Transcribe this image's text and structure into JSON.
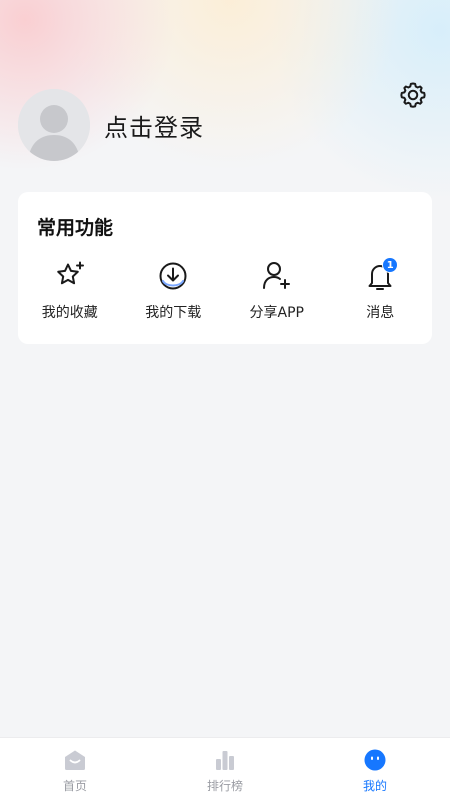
{
  "header": {
    "settings_icon": "gear-icon"
  },
  "profile": {
    "avatar_icon": "user-avatar-placeholder",
    "login_text": "点击登录"
  },
  "common_functions": {
    "title": "常用功能",
    "items": [
      {
        "label": "我的收藏",
        "icon": "star-sparkle-icon"
      },
      {
        "label": "我的下载",
        "icon": "download-icon"
      },
      {
        "label": "分享APP",
        "icon": "add-user-icon"
      },
      {
        "label": "消息",
        "icon": "bell-icon",
        "badge": "1"
      }
    ]
  },
  "tabbar": {
    "tabs": [
      {
        "label": "首页",
        "icon": "home-icon",
        "active": false
      },
      {
        "label": "排行榜",
        "icon": "bar-chart-icon",
        "active": false
      },
      {
        "label": "我的",
        "icon": "smile-face-icon",
        "active": true
      }
    ]
  },
  "colors": {
    "accent": "#1677ff",
    "tab_inactive": "#9a9ca3",
    "background": "#f4f5f7"
  }
}
